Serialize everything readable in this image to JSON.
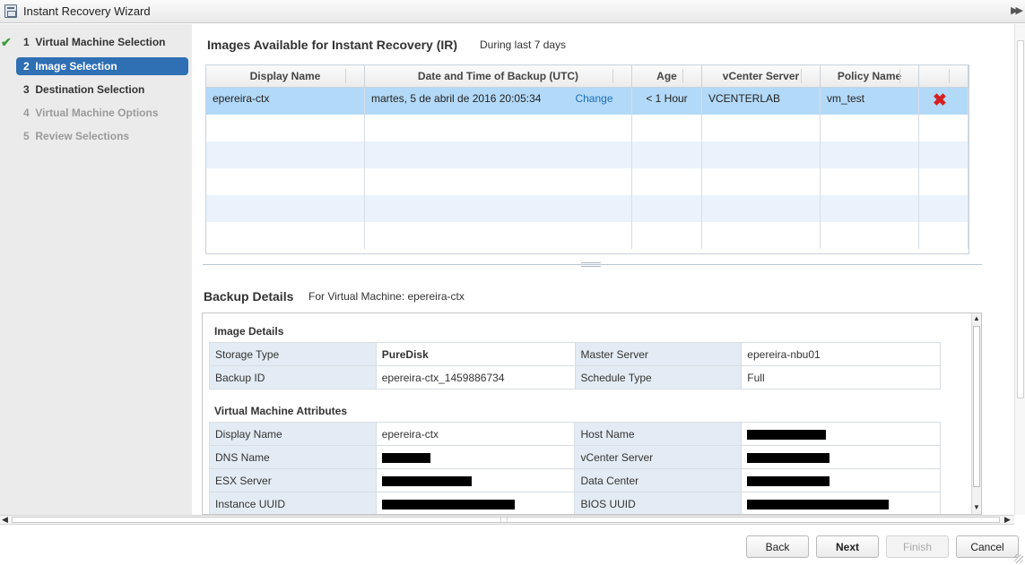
{
  "window": {
    "title": "Instant Recovery Wizard"
  },
  "steps": [
    {
      "number": "1",
      "label": "Virtual Machine Selection",
      "state": "complete"
    },
    {
      "number": "2",
      "label": "Image Selection",
      "state": "active"
    },
    {
      "number": "3",
      "label": "Destination Selection",
      "state": "pending"
    },
    {
      "number": "4",
      "label": "Virtual Machine Options",
      "state": "disabled"
    },
    {
      "number": "5",
      "label": "Review Selections",
      "state": "disabled"
    }
  ],
  "images": {
    "title": "Images Available for Instant Recovery (IR)",
    "subtitle": "During last 7 days",
    "columns": [
      "Display Name",
      "Date and Time of Backup (UTC)",
      "Age",
      "vCenter Server",
      "Policy Name"
    ],
    "rows": [
      {
        "display_name": "epereira-ctx",
        "datetime": "martes, 5 de abril de 2016 20:05:34",
        "change_label": "Change",
        "age": "< 1 Hour",
        "vcenter": "VCENTERLAB",
        "policy": "vm_test"
      }
    ]
  },
  "backup": {
    "title": "Backup Details",
    "subtitle": "For Virtual Machine: epereira-ctx",
    "image_details": {
      "heading": "Image Details",
      "rows": [
        {
          "k1": "Storage Type",
          "v1": "PureDisk",
          "k2": "Master Server",
          "v2": "epereira-nbu01"
        },
        {
          "k1": "Backup ID",
          "v1": "epereira-ctx_1459886734",
          "k2": "Schedule Type",
          "v2": "Full"
        }
      ]
    },
    "vm_attributes": {
      "heading": "Virtual Machine Attributes",
      "rows": [
        {
          "k1": "Display Name",
          "v1": "epereira-ctx",
          "k2": "Host Name",
          "v2": ""
        },
        {
          "k1": "DNS Name",
          "v1": "",
          "k2": "vCenter Server",
          "v2": ""
        },
        {
          "k1": "ESX Server",
          "v1": "",
          "k2": "Data Center",
          "v2": ""
        },
        {
          "k1": "Instance UUID",
          "v1": "",
          "k2": "BIOS UUID",
          "v2": ""
        }
      ]
    }
  },
  "buttons": {
    "back": "Back",
    "next": "Next",
    "finish": "Finish",
    "cancel": "Cancel"
  },
  "colors": {
    "active_step": "#2f6fb4",
    "selected_row": "#b3d9f8",
    "link": "#1a6fb5",
    "delete": "#d52020",
    "check": "#3d9b35"
  }
}
